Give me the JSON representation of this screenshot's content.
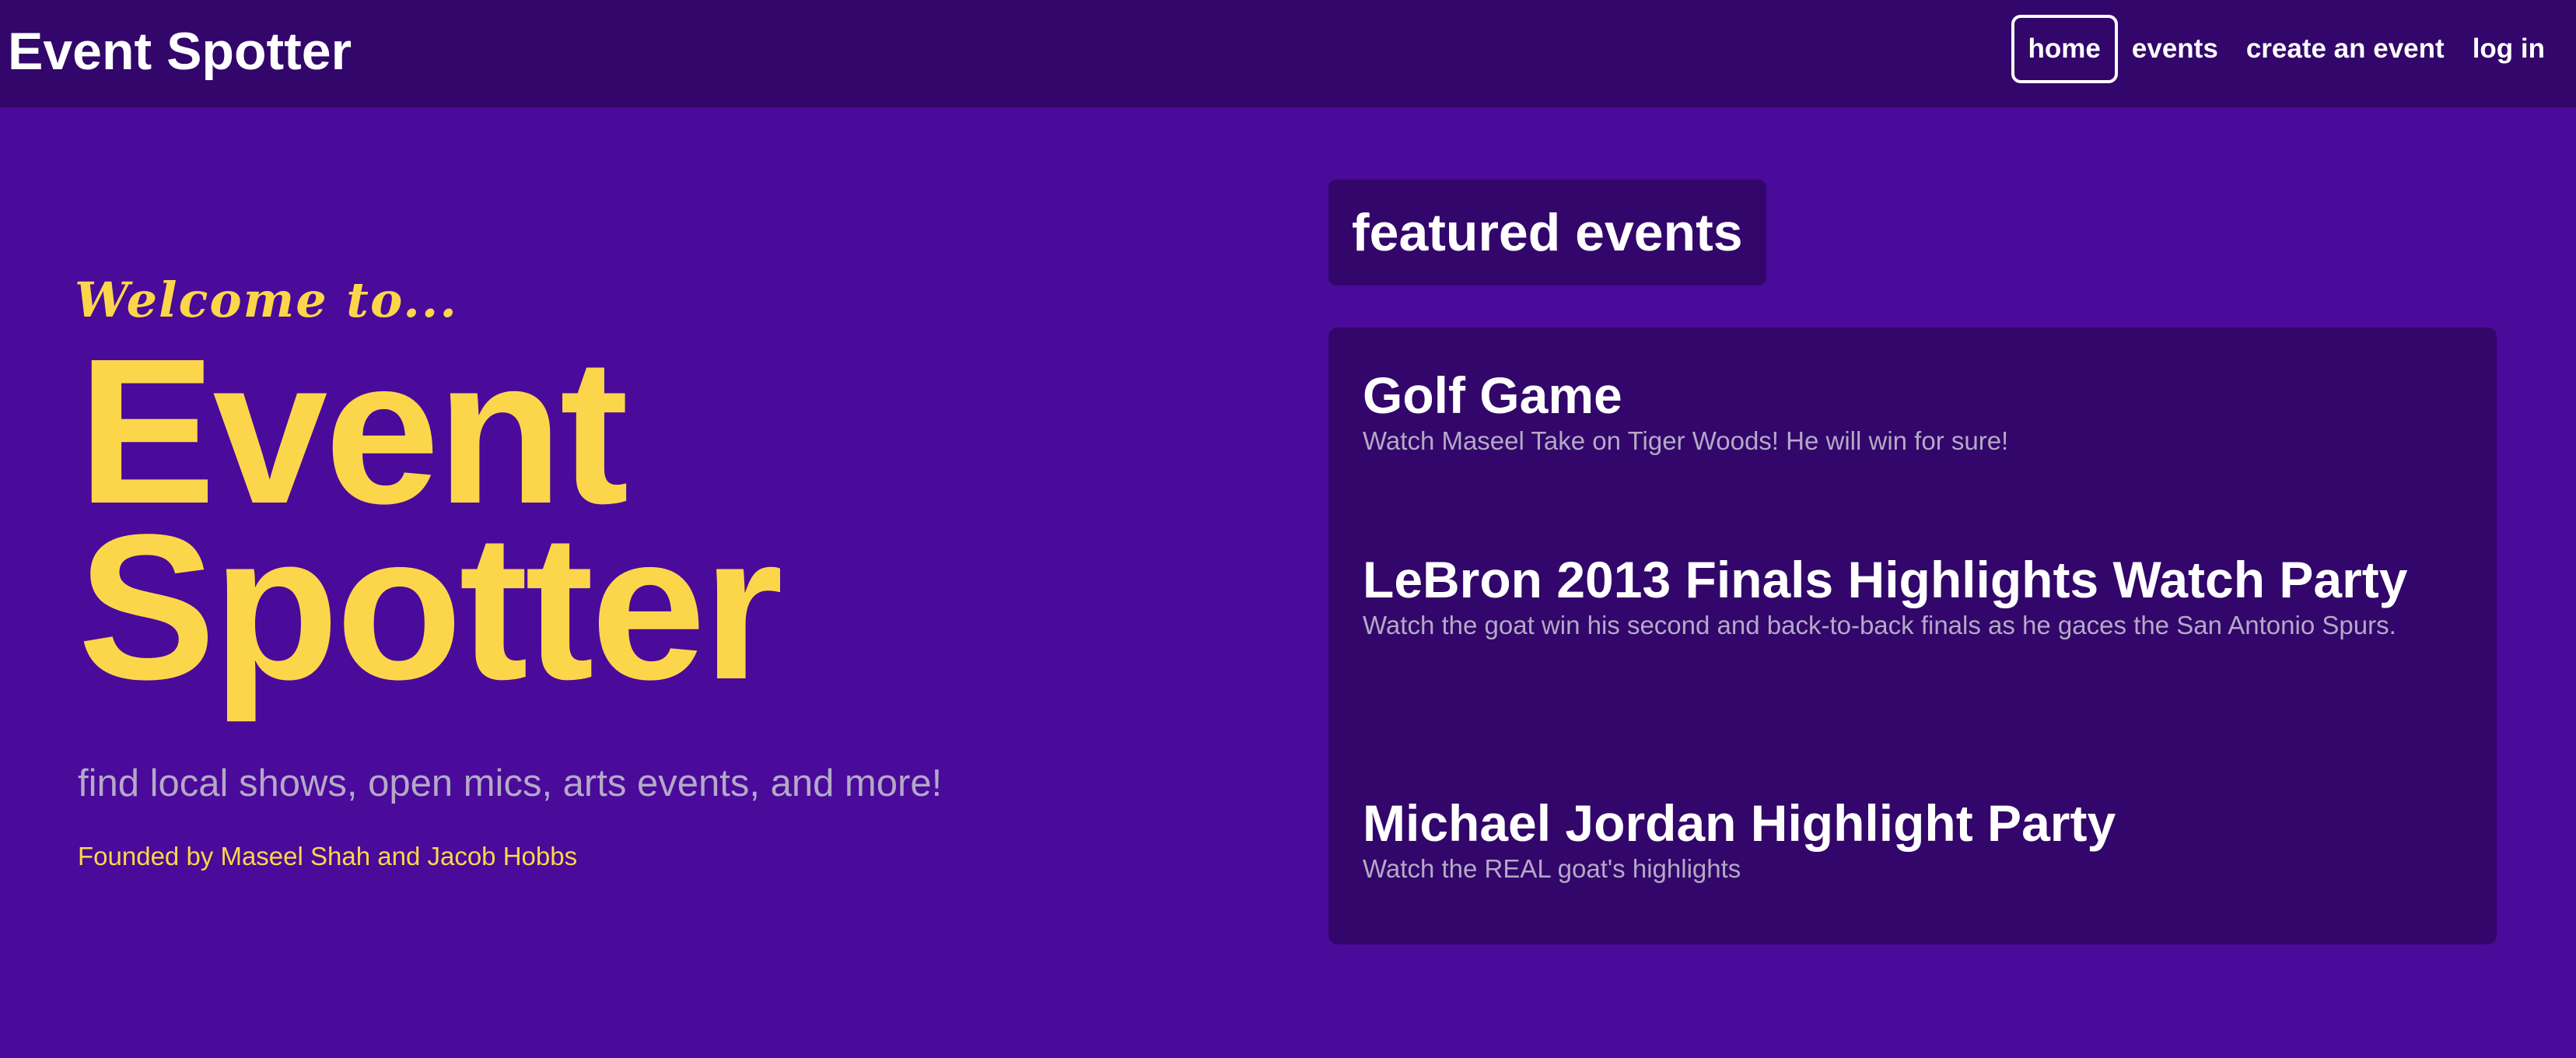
{
  "header": {
    "brand": "Event Spotter",
    "nav": [
      {
        "label": "home",
        "active": true
      },
      {
        "label": "events",
        "active": false
      },
      {
        "label": "create an event",
        "active": false
      },
      {
        "label": "log in",
        "active": false
      }
    ]
  },
  "hero": {
    "welcome": "Welcome to...",
    "title_line1": "Event",
    "title_line2": "Spotter",
    "subtitle": "find local shows, open mics, arts events, and more!",
    "founded": "Founded by Maseel Shah and Jacob Hobbs"
  },
  "featured": {
    "heading": "featured events",
    "events": [
      {
        "title": "Golf Game",
        "description": "Watch Maseel Take on Tiger Woods! He will win for sure!"
      },
      {
        "title": "LeBron 2013 Finals Highlights Watch Party",
        "description": "Watch the goat win his second and back-to-back finals as he gaces the San Antonio Spurs."
      },
      {
        "title": "Michael Jordan Highlight Party",
        "description": "Watch the REAL goat's highlights"
      }
    ]
  },
  "colors": {
    "navbar_bg": "#32066a",
    "page_bg": "#4a0a9a",
    "accent_yellow": "#fcd64a",
    "muted_text": "#b4a9c6",
    "white": "#ffffff"
  }
}
